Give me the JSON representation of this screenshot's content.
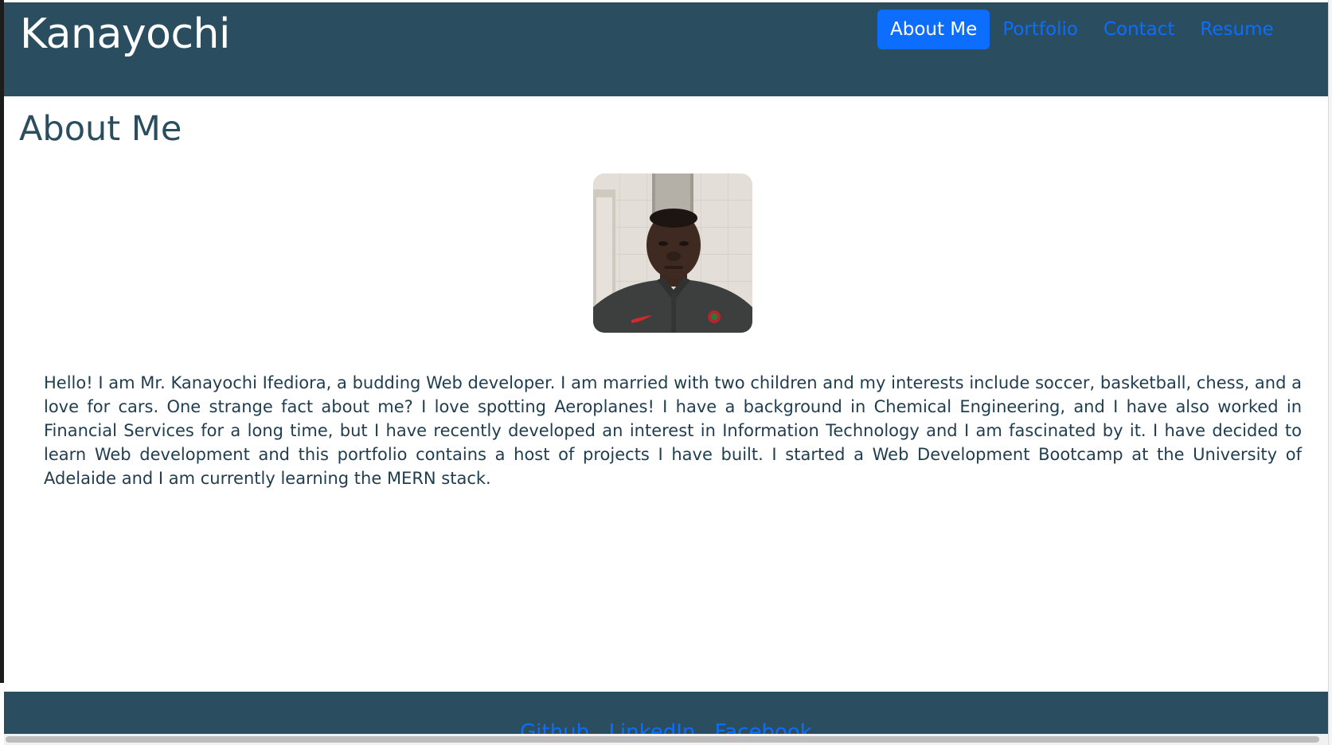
{
  "header": {
    "brand": "Kanayochi",
    "nav": [
      {
        "label": "About Me",
        "active": true
      },
      {
        "label": "Portfolio",
        "active": false
      },
      {
        "label": "Contact",
        "active": false
      },
      {
        "label": "Resume",
        "active": false
      }
    ]
  },
  "main": {
    "title": "About Me",
    "avatar_alt": "profile-photo",
    "bio": "Hello! I am Mr. Kanayochi Ifediora, a budding Web developer. I am married with two children and my interests include soccer, basketball, chess, and a love for cars. One strange fact about me? I love spotting Aeroplanes! I have a background in Chemical Engineering, and I have also worked in Financial Services for a long time, but I have recently developed an interest in Information Technology and I am fascinated by it. I have decided to learn Web development and this portfolio contains a host of projects I have built. I started a Web Development Bootcamp at the University of Adelaide and I am currently learning the MERN stack."
  },
  "footer": {
    "links": [
      "Github",
      "LinkedIn",
      "Facebook"
    ]
  },
  "colors": {
    "header_bg": "#2a4d5f",
    "link": "#0d6efd",
    "active_bg": "#0d6efd",
    "text": "#1f3d4e"
  }
}
